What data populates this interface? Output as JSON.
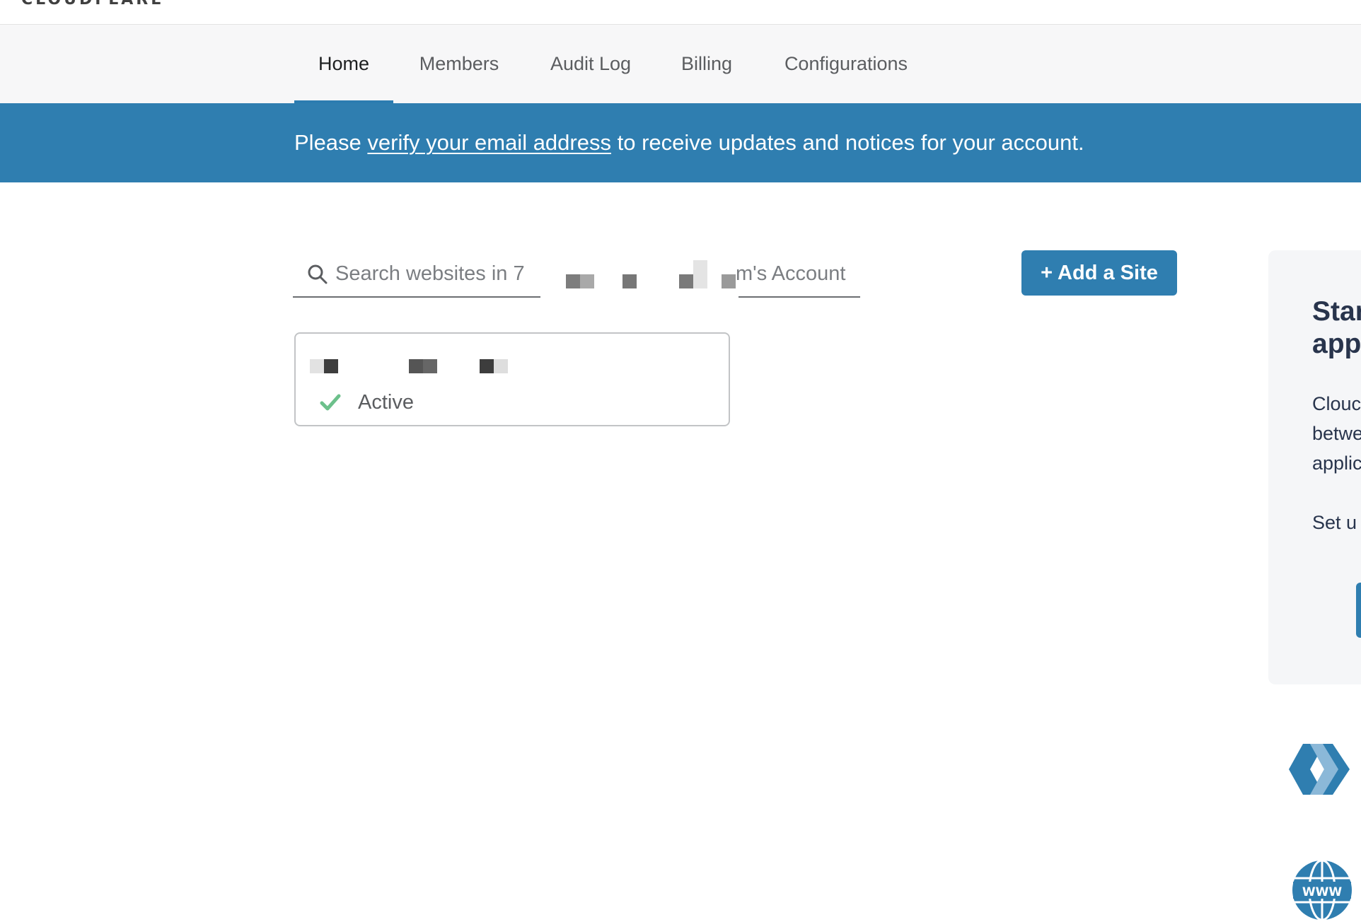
{
  "header": {
    "logo_text": "CLOUDFLARE"
  },
  "tabs": [
    {
      "label": "Home",
      "active": true
    },
    {
      "label": "Members",
      "active": false
    },
    {
      "label": "Audit Log",
      "active": false
    },
    {
      "label": "Billing",
      "active": false
    },
    {
      "label": "Configurations",
      "active": false
    }
  ],
  "banner": {
    "prefix": "Please ",
    "link_text": "verify your email address",
    "suffix": " to receive updates and notices for your account.",
    "color": "#2f7eb0"
  },
  "search": {
    "placeholder": "Search websites in 7",
    "visible_tail": "m's Account",
    "value": ""
  },
  "add_site": {
    "label": "+ Add a Site"
  },
  "site_card": {
    "name": "",
    "status": "Active",
    "status_color": "#6cc08b"
  },
  "side_panel": {
    "title": "Star\napp",
    "body": "Clouc\nbetwe\napplic",
    "setup_text": "Set u"
  },
  "icons": {
    "search": "search-icon",
    "check": "check-icon",
    "cloudflare": "cloudflare-chevron-icon",
    "www": "www-globe-icon"
  },
  "colors": {
    "accent": "#2f7eb0",
    "tab_bg": "#f7f7f8",
    "active_tab_underline": "#2c7cb0",
    "panel_bg": "#f5f6f8",
    "panel_text": "#28344c"
  }
}
